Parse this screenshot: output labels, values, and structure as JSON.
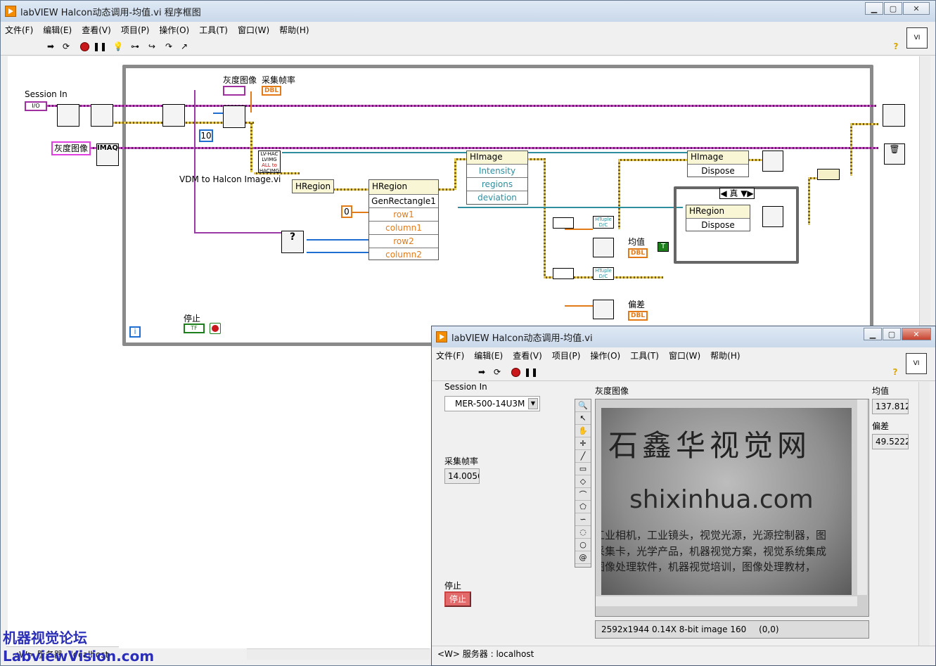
{
  "diagram_window": {
    "title": "labVIEW Halcon动态调用-均值.vi 程序框图",
    "menu": [
      "文件(F)",
      "编辑(E)",
      "查看(V)",
      "项目(P)",
      "操作(O)",
      "工具(T)",
      "窗口(W)",
      "帮助(H)"
    ],
    "labels": {
      "session_in": "Session In",
      "io_tag": "I/O",
      "gray_image_ctrl": "灰度图像",
      "imaq": "IMAQ",
      "gray_image_top": "灰度图像",
      "fps_top": "采集帧率",
      "dbl": "DBL",
      "ten": "10",
      "vdm_to_halcon": "VDM to Halcon Image.vi",
      "vdm_lines": [
        "LV-HAC",
        "LVIMG",
        "ALL to",
        "HACIMG"
      ],
      "hregion1": "HRegion",
      "hregion2": "HRegion",
      "genrect": "GenRectangle1",
      "row1": "row1",
      "column1": "column1",
      "row2": "row2",
      "column2": "column2",
      "zero": "0",
      "himage1": "HImage",
      "intensity": "Intensity",
      "regions": "regions",
      "deviation": "deviation",
      "himage2": "HImage",
      "dispose1": "Dispose",
      "hregion3": "HRegion",
      "dispose2": "Dispose",
      "case_true": "真",
      "tuple1": "HTuple D/C",
      "tuple2": "HTuple D/C",
      "mean_lbl": "均值",
      "dev_lbl": "偏差",
      "stop_lbl": "停止",
      "tf": "TF",
      "info_i": "i",
      "t_const": "T",
      "status": "<W> 服务器 : localhost"
    }
  },
  "front_panel": {
    "title": "labVIEW Halcon动态调用-均值.vi",
    "menu": [
      "文件(F)",
      "编辑(E)",
      "查看(V)",
      "项目(P)",
      "操作(O)",
      "工具(T)",
      "窗口(W)",
      "帮助(H)"
    ],
    "session_in_label": "Session In",
    "session_value": "MER-500-14U3M",
    "fps_label": "采集帧率",
    "fps_value": "14.0056",
    "gray_label": "灰度图像",
    "mean_label": "均值",
    "mean_value": "137.812",
    "dev_label": "偏差",
    "dev_value": "49.5222",
    "stop_label": "停止",
    "stop_button": "停止",
    "image_text": {
      "logo": "石鑫华视觉网",
      "url": "shixinhua.com",
      "line1": "工业相机，工业镜头，视觉光源，光源控制器，图",
      "line2": "采集卡，光学产品，机器视觉方案，视觉系统集成",
      "line3": "图像处理软件，机器视觉培训，图像处理教材，"
    },
    "image_info": "2592x1944 0.14X 8-bit image 160",
    "image_coord": "(0,0)",
    "status": "<W> 服务器 : localhost"
  },
  "watermark": {
    "line1": "机器视觉论坛",
    "line2": "LabviewVision.com"
  },
  "colors": {
    "accent": "#f28c00",
    "wire_pink": "#c04cc0",
    "wire_yellow": "#e2c84a",
    "wire_blue": "#1e6fd1",
    "wire_orange": "#e37a18"
  }
}
